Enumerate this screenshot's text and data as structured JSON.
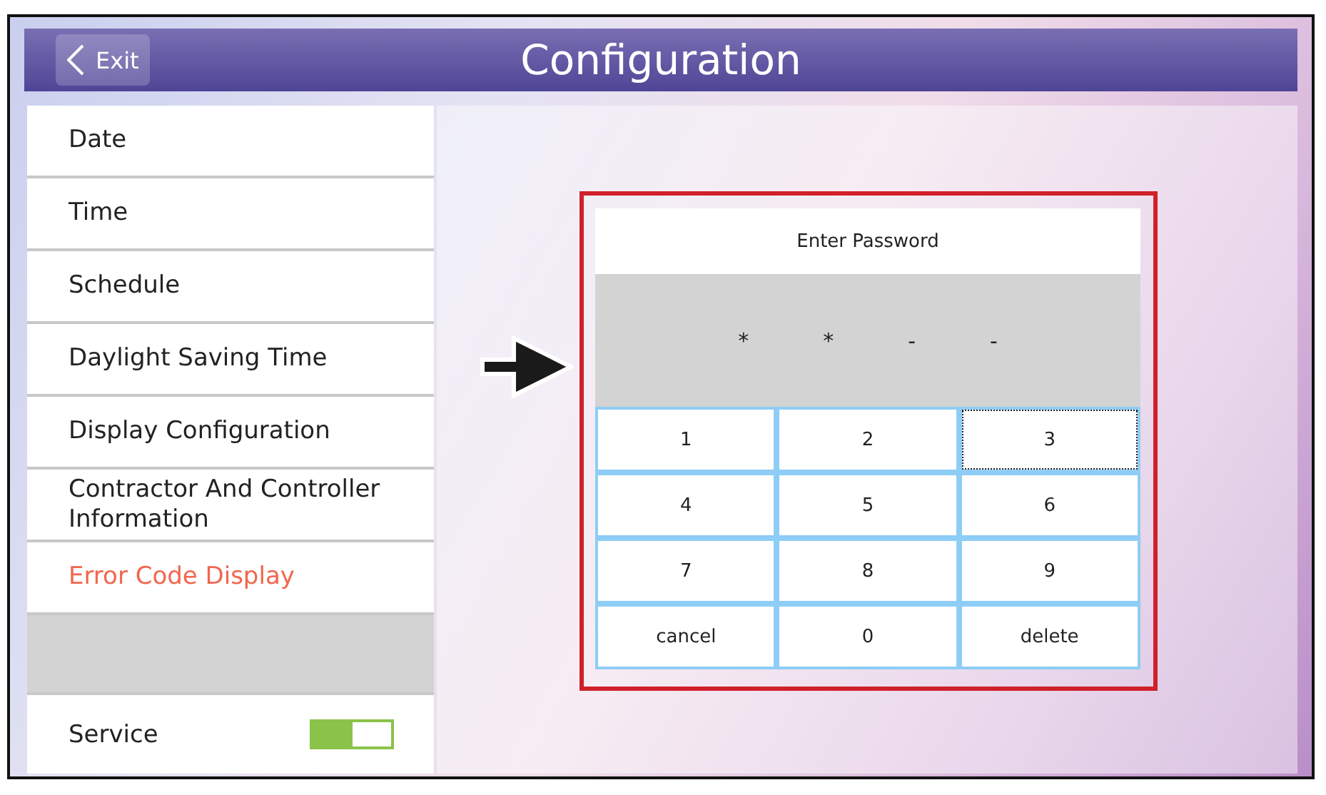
{
  "header": {
    "back_button": "Exit",
    "title": "Configuration"
  },
  "sidebar": {
    "items": [
      {
        "label": "Date",
        "selected": false
      },
      {
        "label": "Time",
        "selected": false
      },
      {
        "label": "Schedule",
        "selected": false
      },
      {
        "label": "Daylight Saving Time",
        "selected": false
      },
      {
        "label": "Display Configuration",
        "selected": false
      },
      {
        "label": "Contractor And Controller Information",
        "selected": false
      },
      {
        "label": "Error Code Display",
        "selected": true
      }
    ],
    "service": {
      "label": "Service",
      "on": true
    }
  },
  "password_dialog": {
    "title": "Enter Password",
    "digits": [
      "*",
      "*",
      "-",
      "-"
    ],
    "keys": [
      {
        "label": "1",
        "focused": false
      },
      {
        "label": "2",
        "focused": false
      },
      {
        "label": "3",
        "focused": true
      },
      {
        "label": "4",
        "focused": false
      },
      {
        "label": "5",
        "focused": false
      },
      {
        "label": "6",
        "focused": false
      },
      {
        "label": "7",
        "focused": false
      },
      {
        "label": "8",
        "focused": false
      },
      {
        "label": "9",
        "focused": false
      },
      {
        "label": "cancel",
        "focused": false
      },
      {
        "label": "0",
        "focused": false
      },
      {
        "label": "delete",
        "focused": false
      }
    ]
  }
}
